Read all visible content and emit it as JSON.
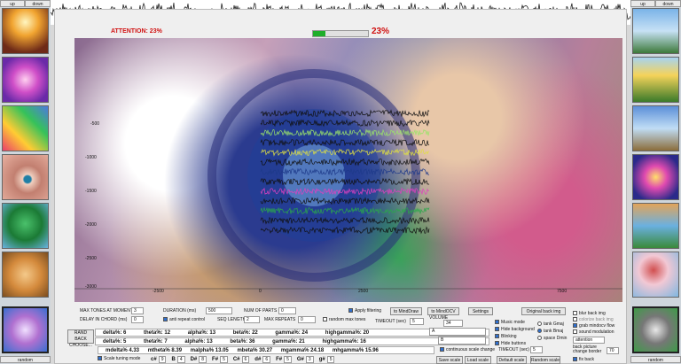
{
  "left_panel": {
    "up_label": "up",
    "down_label": "down",
    "random_label": "random"
  },
  "right_panel": {
    "up_label": "up",
    "down_label": "down",
    "random_label": "random"
  },
  "legend": {
    "raw_signal": "Raw signal"
  },
  "attention": {
    "label": "ATTENTION: 23%",
    "big_value": "23%",
    "progress": 0.23
  },
  "plot_ticks_y": [
    "-500",
    "-1000",
    "-1500",
    "-2000",
    "-2500",
    "-3000"
  ],
  "plot_ticks_x": [
    "-2500",
    "0",
    "2500",
    "7500"
  ],
  "controls": {
    "max_tones_label": "MAX TONES AT MOMENT",
    "max_tones_value": "3",
    "delay_chord_label": "DELAY IN CHORD (ms)",
    "delay_chord_value": "0",
    "duration_label": "DURATION (ms)",
    "duration_value": "500",
    "num_parts_label": "NUM OF PARTS",
    "num_parts_value": "0",
    "anti_repeat_label": "anti repeat control",
    "seq_length_label": "SEQ LENGTH",
    "seq_length_value": "2",
    "max_repeats_label": "MAX REPEATS",
    "max_repeats_value": "0",
    "random_max_tones_label": "random max tones",
    "apply_filtering_label": "Apply filtering",
    "to_minddraw": "to MindDraw",
    "to_mindocv": "to MindOCV",
    "settings": "Settings",
    "timeout_label": "TIMEOUT (sec)",
    "timeout_value": "5",
    "volume_label": "VOLUME",
    "volume_value": "34",
    "original_back_img": "Original back img",
    "randback_choose_line1": "RAND BACK",
    "randback_choose_line2": "CHOOSE...",
    "field_a": "A",
    "field_b": "B",
    "continuous_scale_change": "continuous scale change",
    "timeout2_label": "TIMEOUT (sec)",
    "timeout2_value": "5",
    "scale_tuning_mode": "Scale tuning mode",
    "save_scale": "Save scale",
    "load_scale": "Load scale",
    "default_scale": "Default scale",
    "random_scale": "Random scale"
  },
  "bands": {
    "row1": [
      "delta%: 6",
      "theta%: 12",
      "alpha%: 13",
      "beta%: 22",
      "gamma%: 24",
      "highgamma%: 20"
    ],
    "row2": [
      "delta%: 5",
      "theta%: 7",
      "alpha%: 13",
      "beta%: 36",
      "gamma%: 21",
      "highgamma%: 16"
    ],
    "row3": [
      "mdelta% 4.33",
      "mtheta% 8.39",
      "malpha% 13.05",
      "mbeta% 30.27",
      "mgamma% 24.18",
      "mhgamma% 15.96"
    ]
  },
  "notes": [
    "c#",
    "9",
    "B",
    "4",
    "D#",
    "8",
    "F#",
    "5",
    "C#",
    "6",
    "d#",
    "6",
    "F#",
    "5",
    "G#",
    "3",
    "g#",
    "5"
  ],
  "mode": {
    "music_mode": "Music mode",
    "hide_background": "Hide background",
    "blinking": "Blinking",
    "hide_buttons": "Hide buttons",
    "tank_gmaj": "tank Gmaj",
    "tank_bmaj": "tank Bmaj",
    "space_dmin": "space Dmin",
    "blur_back_img": "blur back img",
    "colorize_back_img": "colorize back img",
    "grab_mindocv_flow": "grab mindocv flow",
    "sound_modulation": "sound modulation",
    "attention_select": "attention",
    "back_picture_change_border": "back picture change border",
    "border_value": "70",
    "fix_back": "fix back"
  }
}
